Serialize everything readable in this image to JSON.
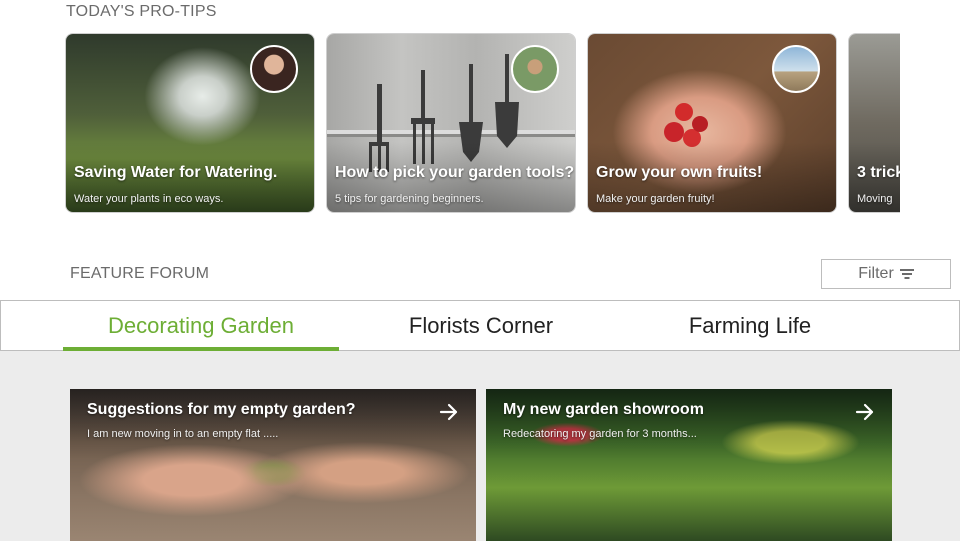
{
  "protips": {
    "title": "TODAY'S PRO-TIPS",
    "cards": [
      {
        "title": "Saving Water for Watering.",
        "subtitle": "Water your plants in eco ways."
      },
      {
        "title": "How to pick your garden tools?",
        "subtitle": "5 tips for gardening beginners."
      },
      {
        "title": "Grow your own fruits!",
        "subtitle": "Make your garden fruity!"
      },
      {
        "title": "3 trick",
        "subtitle": "Moving"
      }
    ]
  },
  "forum": {
    "title": "FEATURE FORUM",
    "filter_label": "Filter",
    "tabs": [
      {
        "label": "Decorating Garden",
        "active": true
      },
      {
        "label": "Florists Corner",
        "active": false
      },
      {
        "label": "Farming Life",
        "active": false
      }
    ],
    "posts": [
      {
        "title": "Suggestions for my empty garden?",
        "subtitle": "I am new moving in to an empty flat ....."
      },
      {
        "title": "My new garden showroom",
        "subtitle": "Redecatoring my garden for 3 months..."
      }
    ]
  },
  "colors": {
    "accent": "#6dae35",
    "text_muted": "#6b6b6b",
    "forum_background": "#ececec"
  }
}
